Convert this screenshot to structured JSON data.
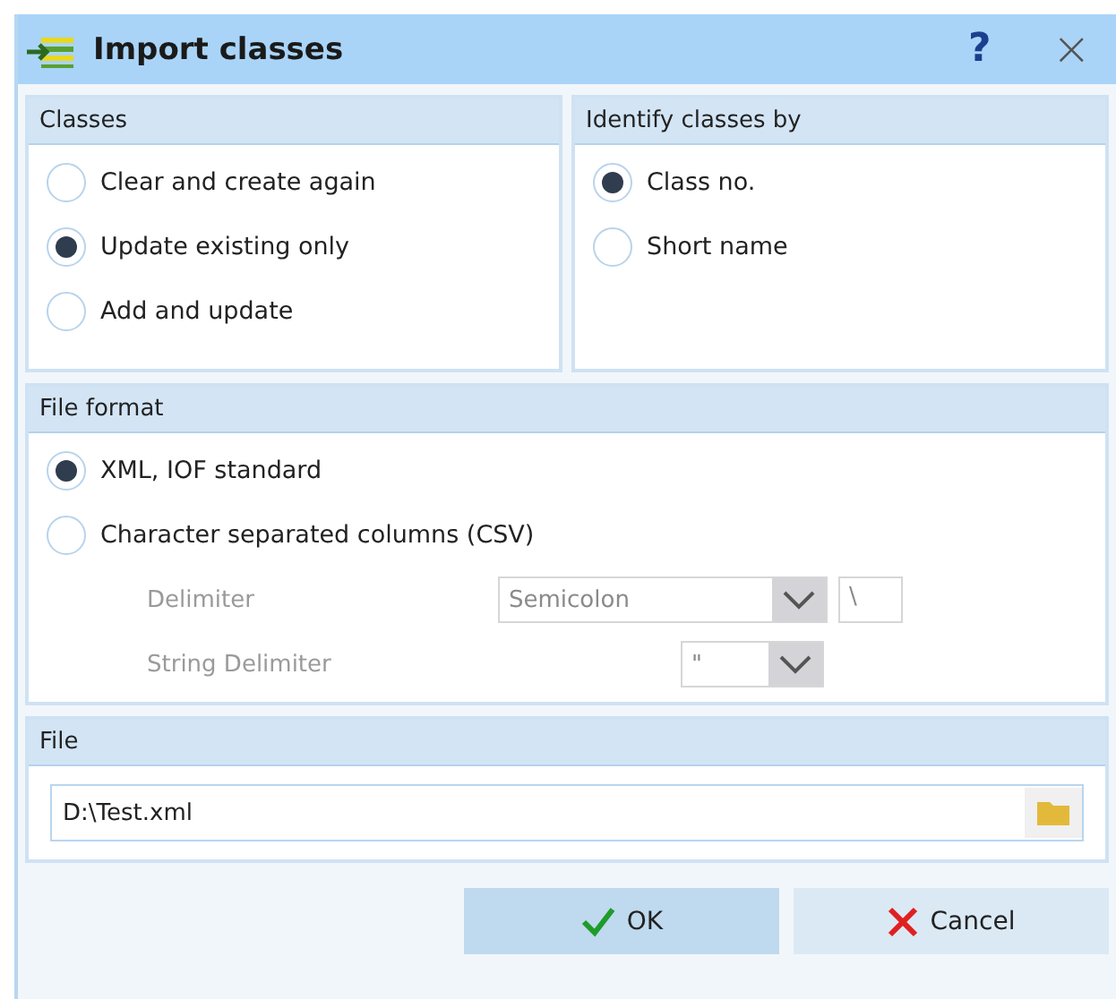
{
  "window": {
    "title": "Import classes",
    "help": "?",
    "close": "×"
  },
  "panels": [
    {
      "title": "Classes",
      "options": [
        {
          "label": "Clear and create again",
          "selected": false
        },
        {
          "label": "Update existing only",
          "selected": true
        },
        {
          "label": "Add and update",
          "selected": false
        }
      ]
    },
    {
      "title": "Identify classes by",
      "options": [
        {
          "label": "Class no.",
          "selected": true
        },
        {
          "label": "Short name",
          "selected": false
        }
      ]
    }
  ],
  "file_format": {
    "title": "File format",
    "options": [
      {
        "label": "XML, IOF standard",
        "selected": true
      },
      {
        "label": "Character separated columns (CSV)",
        "selected": false
      }
    ],
    "delimiter": {
      "label": "Delimiter",
      "value": "Semicolon",
      "extra": "\\",
      "disabled": true
    },
    "string_delimiter": {
      "label": "String Delimiter",
      "value": "\"",
      "disabled": true
    }
  },
  "file": {
    "title": "File",
    "value": "D:\\Test.xml"
  },
  "buttons": [
    {
      "label": "OK",
      "kind": "ok"
    },
    {
      "label": "Cancel",
      "kind": "cancel"
    }
  ]
}
